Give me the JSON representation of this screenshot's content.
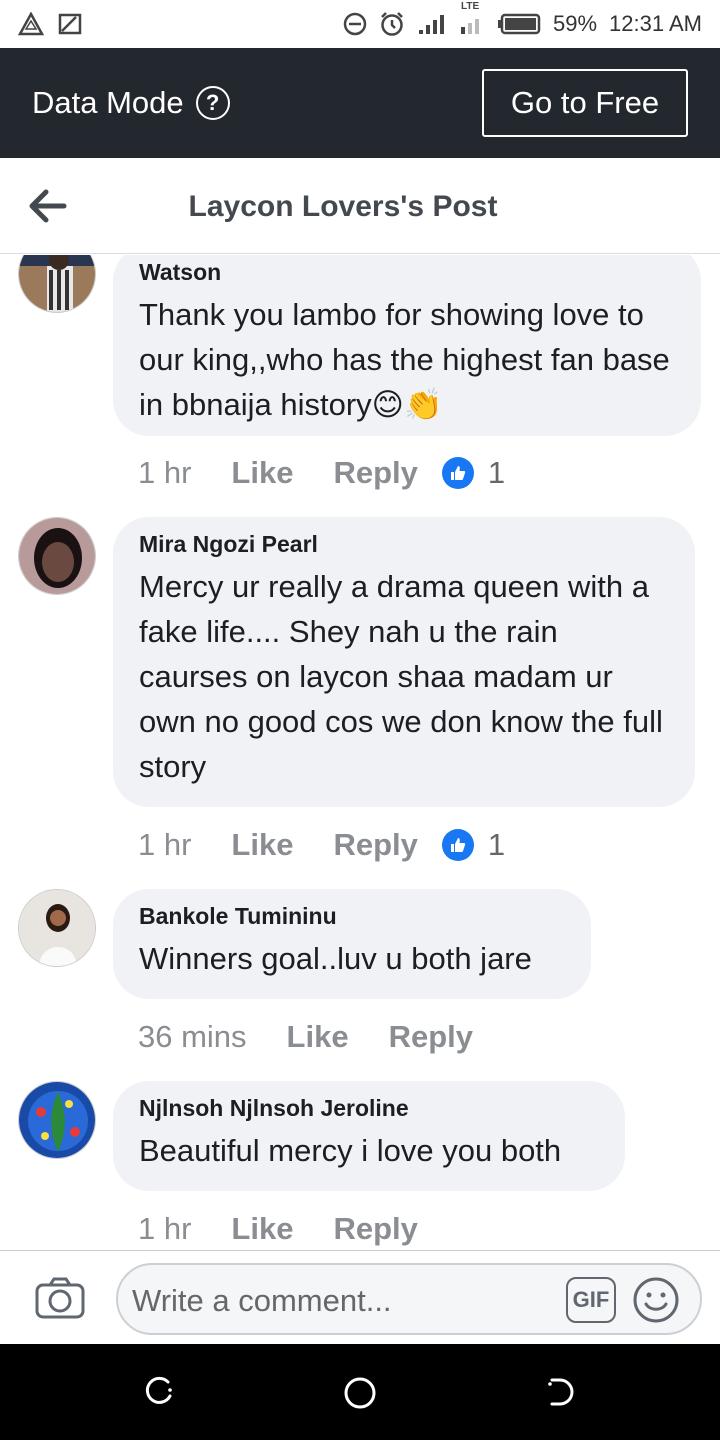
{
  "status_bar": {
    "network_label": "LTE",
    "battery": "59%",
    "time": "12:31 AM"
  },
  "data_mode": {
    "label": "Data Mode",
    "help_icon": "question-circle-icon",
    "go_free_label": "Go to Free"
  },
  "header": {
    "back_icon": "arrow-left-icon",
    "title": "Laycon Lovers's Post"
  },
  "comments": [
    {
      "name": "Watson",
      "text": "Thank you lambo for showing love to our king,,who has the highest fan base in bbnaija history😊👏",
      "time": "1 hr",
      "like_label": "Like",
      "reply_label": "Reply",
      "reactions": "1"
    },
    {
      "name": "Mira Ngozi Pearl",
      "text": "Mercy ur really a drama queen with a fake life.... Shey nah u the rain caurses on laycon shaa madam ur own no good cos we don know the full story",
      "time": "1 hr",
      "like_label": "Like",
      "reply_label": "Reply",
      "reactions": "1"
    },
    {
      "name": "Bankole Tumininu",
      "text": "Winners goal..luv u both jare",
      "time": "36 mins",
      "like_label": "Like",
      "reply_label": "Reply"
    },
    {
      "name": "Njlnsoh Njlnsoh Jeroline",
      "text": "Beautiful mercy i love you both",
      "time": "1 hr",
      "like_label": "Like",
      "reply_label": "Reply"
    }
  ],
  "composer": {
    "placeholder": "Write a comment...",
    "gif_label": "GIF",
    "camera_icon": "camera-icon",
    "emoji_icon": "smiley-icon"
  },
  "colors": {
    "data_bar_bg": "#23272e",
    "bubble_bg": "#f0f2f5",
    "like_blue": "#1877f2",
    "meta_gray": "#8a8d91"
  }
}
